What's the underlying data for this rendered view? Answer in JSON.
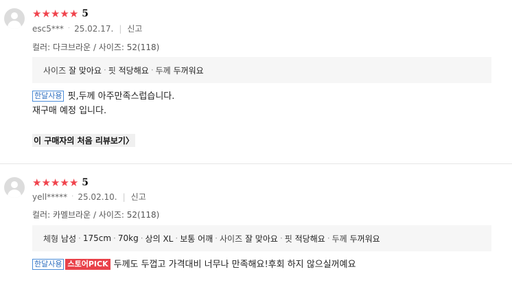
{
  "reviews": [
    {
      "score": "5",
      "user": "esc5***",
      "date": "25.02.17.",
      "report": "신고",
      "option": "컬러: 다크브라운 / 사이즈: 52(118)",
      "survey": [
        {
          "k": "사이즈",
          "v": "잘 맞아요"
        },
        {
          "k": "핏",
          "v": "적당해요"
        },
        {
          "k": "두께",
          "v": "두꺼워요"
        }
      ],
      "badges": [
        "한달사용"
      ],
      "text_line1": "핏,두께 아주만족스럽습니다.",
      "text_line2": "재구매 예정 입니다.",
      "first_review_link": "이 구매자의 처음 리뷰보기"
    },
    {
      "score": "5",
      "user": "yell*****",
      "date": "25.02.10.",
      "report": "신고",
      "option": "컬러: 카멜브라운 / 사이즈: 52(118)",
      "body_info": {
        "label": "체형",
        "gender": "남성",
        "height": "175cm",
        "weight": "70kg",
        "top_size": "상의 XL",
        "shoulder": "보통 어깨"
      },
      "survey": [
        {
          "k": "사이즈",
          "v": "잘 맞아요"
        },
        {
          "k": "핏",
          "v": "적당해요"
        },
        {
          "k": "두께",
          "v": "두꺼워요"
        }
      ],
      "badges": [
        "한달사용",
        "스토어PICK"
      ],
      "text_line1": "두께도 두껍고 가격대비 너무나 만족해요!후회 하지 않으실꺼예요"
    }
  ],
  "colors": {
    "star": "#f0434c",
    "badge_blue": "#2f6fc0",
    "badge_pick_bg": "#e9424a",
    "survey_bg": "#f6f6f6"
  }
}
